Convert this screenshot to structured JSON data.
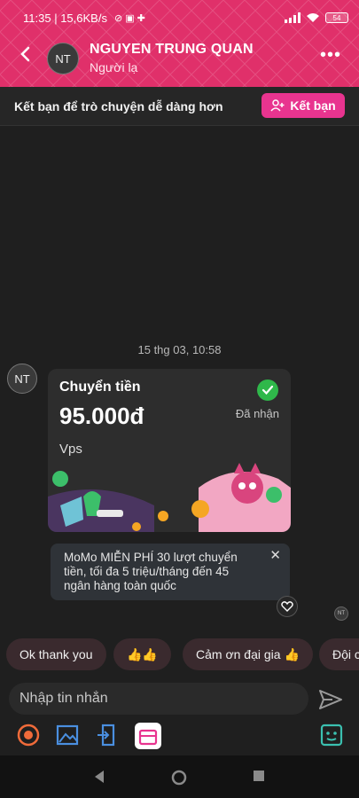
{
  "status_bar": {
    "time": "11:35",
    "network_speed": "15,6KB/s",
    "battery": "54",
    "signal_bars": 4
  },
  "header": {
    "avatar_initials": "NT",
    "name": "NGUYEN TRUNG QUAN",
    "subtitle": "Người lạ",
    "more_label": "•••",
    "background_color": "#e0306a"
  },
  "friend_bar": {
    "text": "Kết bạn để trò chuyện dễ dàng hơn",
    "button_label": "Kết bạn",
    "button_color": "#e8348f"
  },
  "chat": {
    "timestamp": "15 thg 03, 10:58",
    "sender_initials": "NT",
    "transfer_card": {
      "title": "Chuyển tiền",
      "amount": "95.000đ",
      "status": "Đã nhận",
      "note": "Vps",
      "status_color": "#2fb84a"
    },
    "promo": {
      "text": "MoMo MIỄN PHÍ 30 lượt chuyển tiền, tối đa 5 triệu/tháng đến 45 ngân hàng toàn quốc",
      "close_label": "✕"
    },
    "seen_initials": "NT"
  },
  "quick_replies": [
    "Ok thank you",
    "👍👍",
    "Cảm ơn đại gia 👍",
    "Đội c"
  ],
  "composer": {
    "placeholder": "Nhập tin nhắn"
  },
  "toolbar": {
    "icons": [
      "sticker-icon",
      "gallery-icon",
      "transfer-icon",
      "gift-icon",
      "emoji-face-icon"
    ]
  }
}
